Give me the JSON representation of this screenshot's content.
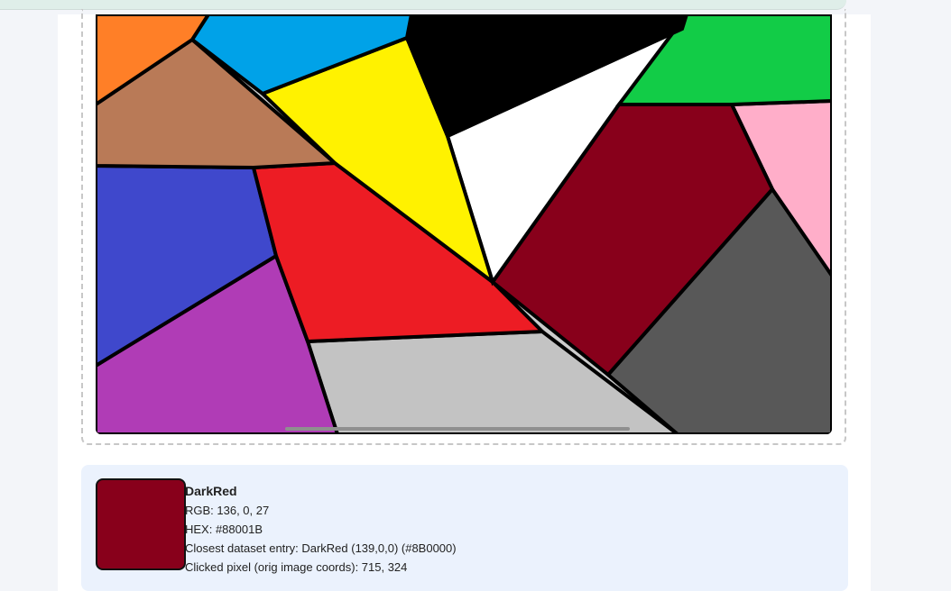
{
  "color_info": {
    "name": "DarkRed",
    "rgb": "RGB: 136, 0, 27",
    "hex": "HEX: #88001B",
    "closest": "Closest dataset entry: DarkRed (139,0,0) (#8B0000)",
    "clicked": "Clicked pixel (orig image coords): 715, 324",
    "swatch_color": "#88001B"
  },
  "palette": {
    "orange": "#ff7f27",
    "sky": "#00a2e8",
    "black": "#000000",
    "green": "#12cc47",
    "brown": "#b97a57",
    "yellow": "#fff200",
    "white": "#ffffff",
    "darkred": "#88001b",
    "pink": "#ffaec9",
    "blue": "#3f48cc",
    "red": "#ed1c24",
    "gray": "#585858",
    "purple": "#b03cb6",
    "lightgray": "#c3c3c3"
  }
}
